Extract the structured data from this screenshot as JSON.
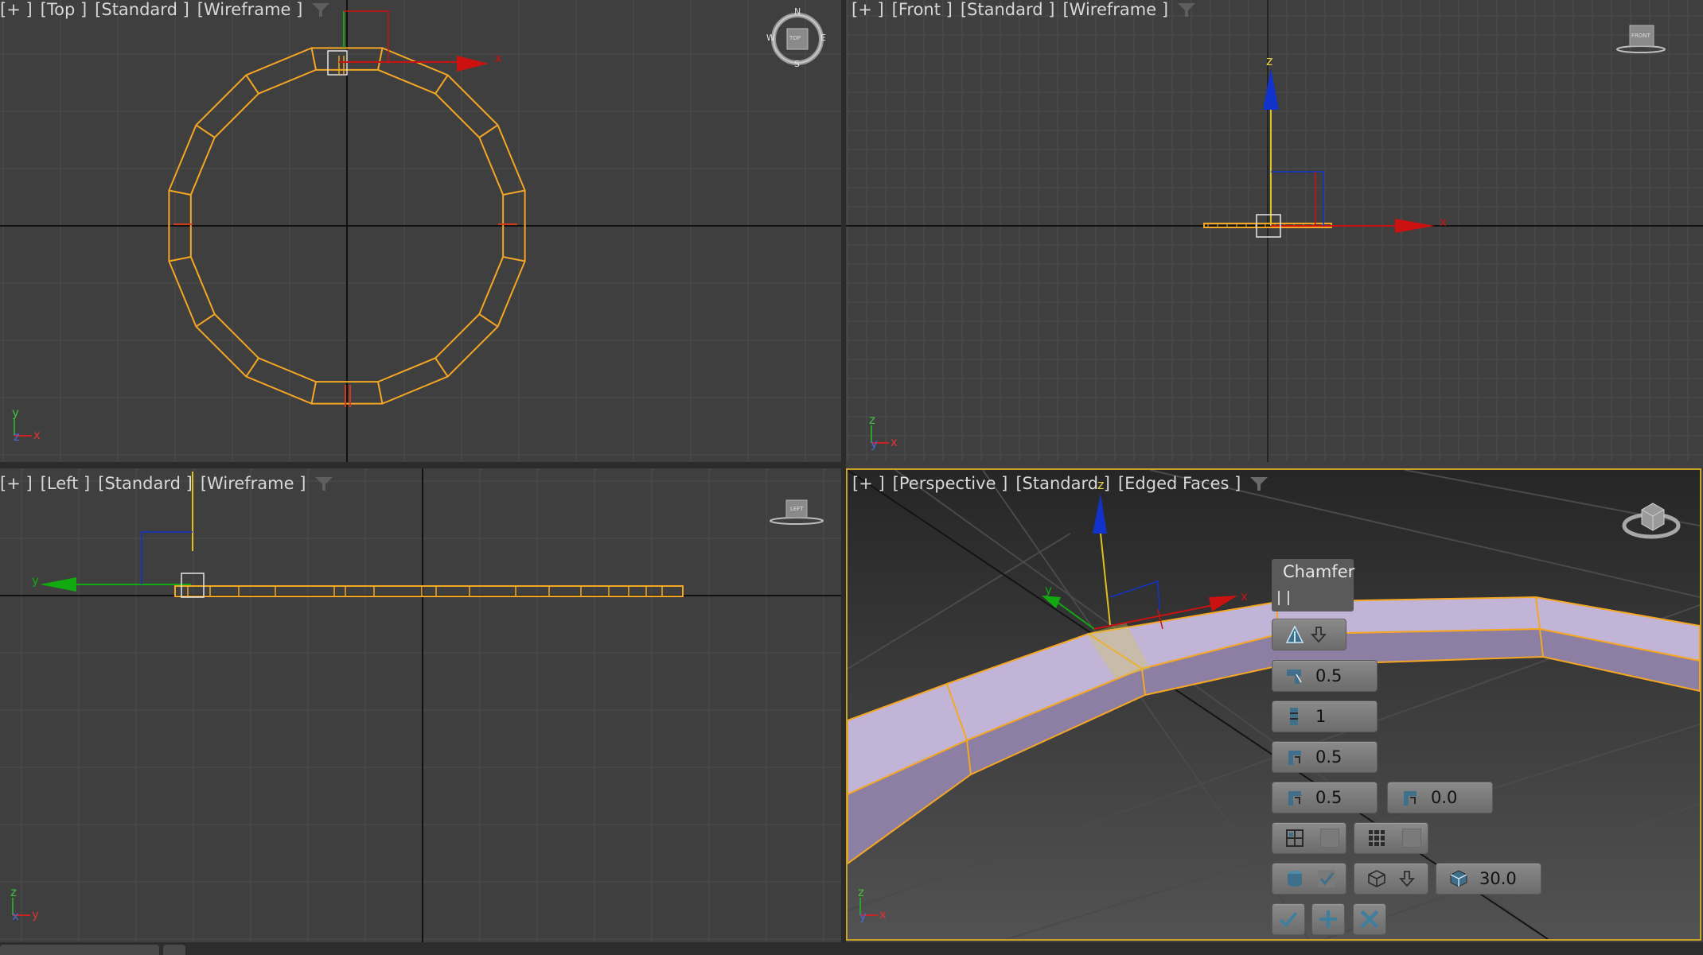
{
  "viewports": {
    "top": {
      "plus": "[+ ]",
      "name": "[Top ]",
      "shading": "[Standard ]",
      "mode": "[Wireframe ]",
      "compass_n": "N",
      "compass_s": "S",
      "compass_e": "E",
      "compass_w": "W",
      "cube": "TOP"
    },
    "front": {
      "plus": "[+ ]",
      "name": "[Front ]",
      "shading": "[Standard ]",
      "mode": "[Wireframe ]",
      "cube": "FRONT"
    },
    "left": {
      "plus": "[+ ]",
      "name": "[Left ]",
      "shading": "[Standard ]",
      "mode": "[Wireframe ]",
      "cube": "LEFT"
    },
    "perspective": {
      "plus": "[+ ]",
      "name": "[Perspective ]",
      "shading": "[Standard ]",
      "mode": "[Edged Faces ]"
    }
  },
  "axes": {
    "x": "x",
    "y": "y",
    "z": "z"
  },
  "chamfer_caddy": {
    "title": "Chamfer",
    "amount": "0.5",
    "segments": "1",
    "tension": "0.5",
    "inset_amount": "0.5",
    "depth": "0.0",
    "smooth_threshold": "30.0",
    "icons": {
      "mode": "chamfer-type-icon",
      "toggle": "arrow-down-icon",
      "amount": "amount-icon",
      "segments": "segments-icon",
      "tension": "tension-icon",
      "inset": "inset-icon",
      "depth": "depth-icon",
      "ok": "check-icon",
      "apply": "plus-icon",
      "cancel": "x-icon"
    }
  },
  "colors": {
    "viewport_bg": "#3f3f3f",
    "grid": "#4d4d4d",
    "selection": "#f5a623",
    "x_axis": "#cc1111",
    "y_axis": "#11aa11",
    "z_axis": "#1133cc",
    "active_border": "#c9a227",
    "object_fill": "#b8a7cc"
  }
}
